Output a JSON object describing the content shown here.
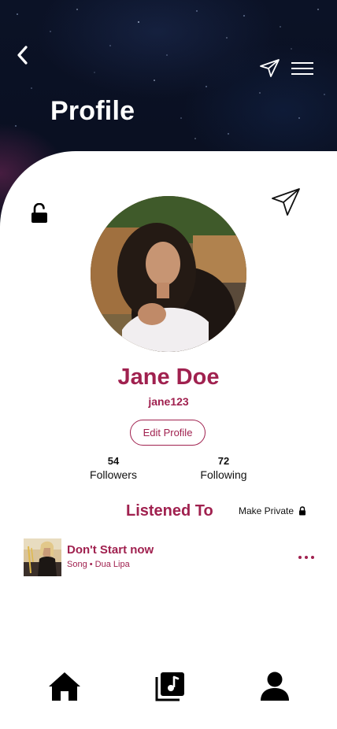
{
  "header": {
    "title": "Profile",
    "back_icon": "chevron-left-icon",
    "send_icon": "paper-plane-icon",
    "menu_icon": "hamburger-menu-icon"
  },
  "profile": {
    "name": "Jane Doe",
    "username": "jane123",
    "edit_label": "Edit Profile",
    "privacy_icon": "unlocked-padlock-icon",
    "share_icon": "paper-plane-icon",
    "followers": {
      "count": "54",
      "label": "Followers"
    },
    "following": {
      "count": "72",
      "label": "Following"
    }
  },
  "listened_to": {
    "title": "Listened To",
    "make_private_label": "Make Private",
    "tracks": [
      {
        "title": "Don't Start now",
        "type": "Song",
        "separator": "•",
        "artist": "Dua Lipa",
        "subtitle": "Song • Dua Lipa"
      }
    ]
  },
  "bottom_nav": {
    "items": [
      {
        "name": "home",
        "icon": "home-icon"
      },
      {
        "name": "library",
        "icon": "music-library-icon"
      },
      {
        "name": "profile",
        "icon": "user-icon",
        "active": true
      }
    ]
  },
  "colors": {
    "accent": "#a0214f",
    "header_background": "#0b1226",
    "text": "#111111",
    "background": "#ffffff"
  }
}
